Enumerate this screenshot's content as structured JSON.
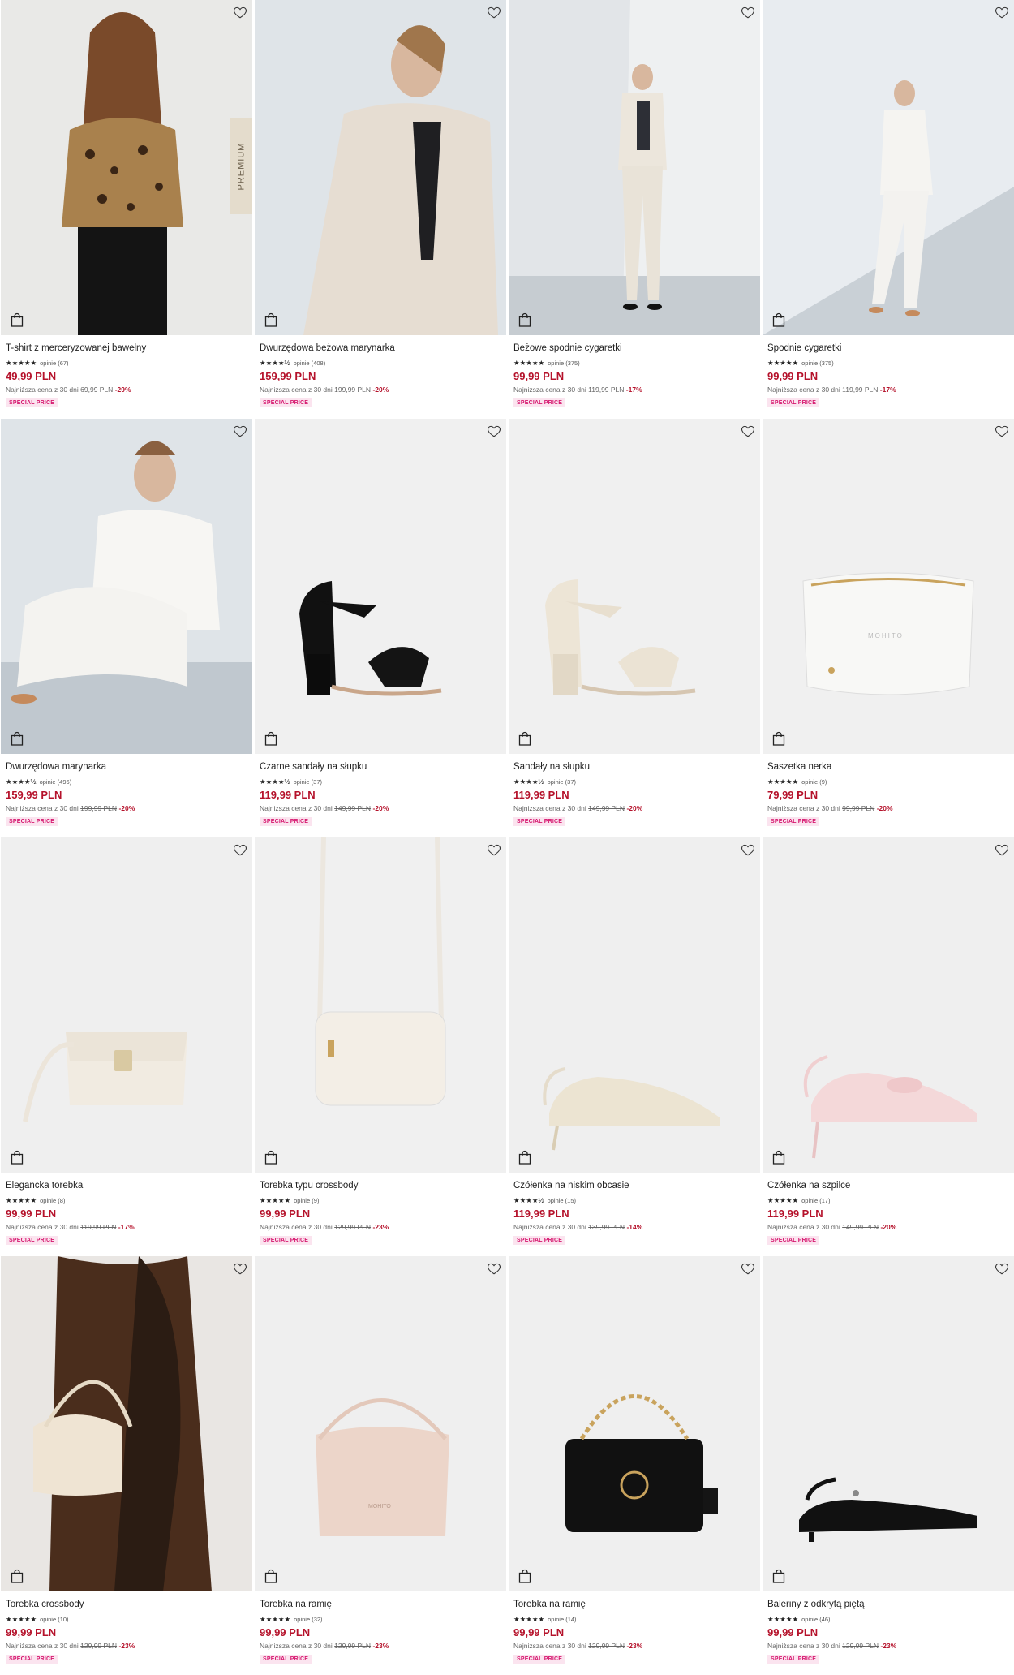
{
  "lowest_label": "Najniższa cena z 30 dni",
  "badge_label": "SPECIAL PRICE",
  "premium_label": "PREMIUM",
  "reviews_prefix": "opinie",
  "products": [
    {
      "name": "T-shirt z merceryzowanej bawełny",
      "reviews": "(67)",
      "price": "49,99 PLN",
      "old_price": "69,99 PLN",
      "discount": "-29%",
      "image": "leopard-tshirt-model",
      "stars": "★★★★★"
    },
    {
      "name": "Dwurzędowa beżowa marynarka",
      "reviews": "(408)",
      "price": "159,99 PLN",
      "old_price": "199,99 PLN",
      "discount": "-20%",
      "image": "beige-blazer-model",
      "stars": "★★★★½"
    },
    {
      "name": "Beżowe spodnie cygaretki",
      "reviews": "(375)",
      "price": "99,99 PLN",
      "old_price": "119,99 PLN",
      "discount": "-17%",
      "image": "beige-trousers-model",
      "stars": "★★★★★"
    },
    {
      "name": "Spodnie cygaretki",
      "reviews": "(375)",
      "price": "99,99 PLN",
      "old_price": "119,99 PLN",
      "discount": "-17%",
      "image": "white-trousers-model",
      "stars": "★★★★★"
    },
    {
      "name": "Dwurzędowa marynarka",
      "reviews": "(496)",
      "price": "159,99 PLN",
      "old_price": "199,99 PLN",
      "discount": "-20%",
      "image": "white-blazer-model",
      "stars": "★★★★½"
    },
    {
      "name": "Czarne sandały na słupku",
      "reviews": "(37)",
      "price": "119,99 PLN",
      "old_price": "149,99 PLN",
      "discount": "-20%",
      "image": "black-sandal",
      "stars": "★★★★½"
    },
    {
      "name": "Sandały na słupku",
      "reviews": "(37)",
      "price": "119,99 PLN",
      "old_price": "149,99 PLN",
      "discount": "-20%",
      "image": "beige-sandal",
      "stars": "★★★★½"
    },
    {
      "name": "Saszetka nerka",
      "reviews": "(9)",
      "price": "79,99 PLN",
      "old_price": "99,99 PLN",
      "discount": "-20%",
      "image": "white-belt-bag",
      "stars": "★★★★★"
    },
    {
      "name": "Elegancka torebka",
      "reviews": "(8)",
      "price": "99,99 PLN",
      "old_price": "119,99 PLN",
      "discount": "-17%",
      "image": "white-handbag",
      "stars": "★★★★★"
    },
    {
      "name": "Torebka typu crossbody",
      "reviews": "(9)",
      "price": "99,99 PLN",
      "old_price": "129,99 PLN",
      "discount": "-23%",
      "image": "white-crossbody",
      "stars": "★★★★★"
    },
    {
      "name": "Czółenka na niskim obcasie",
      "reviews": "(15)",
      "price": "119,99 PLN",
      "old_price": "139,99 PLN",
      "discount": "-14%",
      "image": "beige-slingback",
      "stars": "★★★★½"
    },
    {
      "name": "Czółenka na szpilce",
      "reviews": "(17)",
      "price": "119,99 PLN",
      "old_price": "149,99 PLN",
      "discount": "-20%",
      "image": "pink-slingback",
      "stars": "★★★★★"
    },
    {
      "name": "Torebka crossbody",
      "reviews": "(10)",
      "price": "99,99 PLN",
      "old_price": "129,99 PLN",
      "discount": "-23%",
      "image": "cream-bag-model",
      "stars": "★★★★★"
    },
    {
      "name": "Torebka na ramię",
      "reviews": "(32)",
      "price": "99,99 PLN",
      "old_price": "129,99 PLN",
      "discount": "-23%",
      "image": "pink-shoulder-bag",
      "stars": "★★★★★"
    },
    {
      "name": "Torebka na ramię",
      "reviews": "(14)",
      "price": "99,99 PLN",
      "old_price": "129,99 PLN",
      "discount": "-23%",
      "image": "black-chain-bag",
      "stars": "★★★★★"
    },
    {
      "name": "Baleriny z odkrytą piętą",
      "reviews": "(46)",
      "price": "99,99 PLN",
      "old_price": "129,99 PLN",
      "discount": "-23%",
      "image": "black-ballerinas",
      "stars": "★★★★★"
    }
  ]
}
